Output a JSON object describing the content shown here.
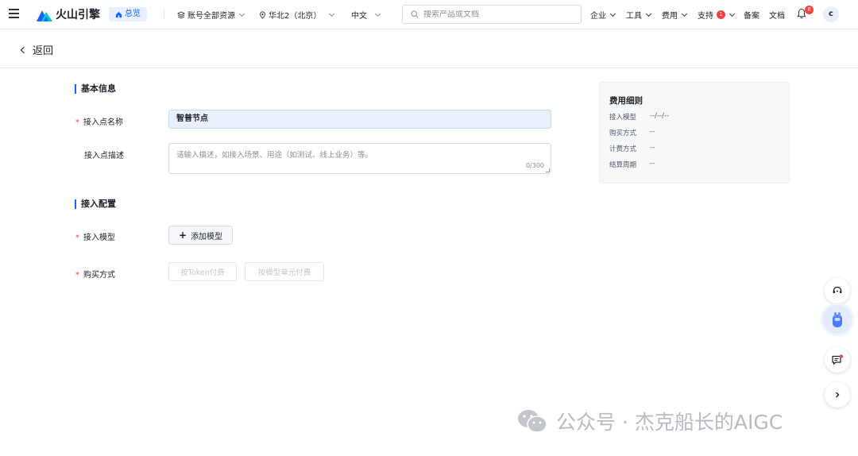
{
  "topbar": {
    "brand": "火山引擎",
    "overview_label": "总览",
    "account_resources": "账号全部资源",
    "region": "华北2（北京）",
    "language": "中文",
    "search_placeholder": "搜索产品或文档",
    "enterprise": "企业",
    "tools": "工具",
    "billing": "费用",
    "support": "支持",
    "support_badge": "1",
    "filing": "备案",
    "docs": "文档",
    "notifications_badge": "8",
    "avatar_initial": "c"
  },
  "back_label": "返回",
  "basic_info": {
    "title": "基本信息",
    "name_label": "接入点名称",
    "name_value": "智普节点",
    "desc_label": "接入点描述",
    "desc_placeholder": "请输入描述，如接入场景、用途（如测试、线上业务）等。",
    "desc_count": "0/300"
  },
  "access_config": {
    "title": "接入配置",
    "model_label": "接入模型",
    "add_model_label": "添加模型",
    "purchase_label": "购买方式",
    "purchase_options": [
      "按Token付费",
      "按模型单元付费"
    ]
  },
  "fee_details": {
    "title": "费用细则",
    "rows": [
      {
        "key": "接入模型",
        "value": "--/--/--"
      },
      {
        "key": "购买方式",
        "value": "--"
      },
      {
        "key": "计费方式",
        "value": "--"
      },
      {
        "key": "结算周期",
        "value": "--"
      }
    ]
  },
  "watermark": "公众号 · 杰克船长的AIGC",
  "colors": {
    "accent": "#1664ff",
    "required": "#f53f3f",
    "input_filled_bg": "#e8f0fe"
  }
}
